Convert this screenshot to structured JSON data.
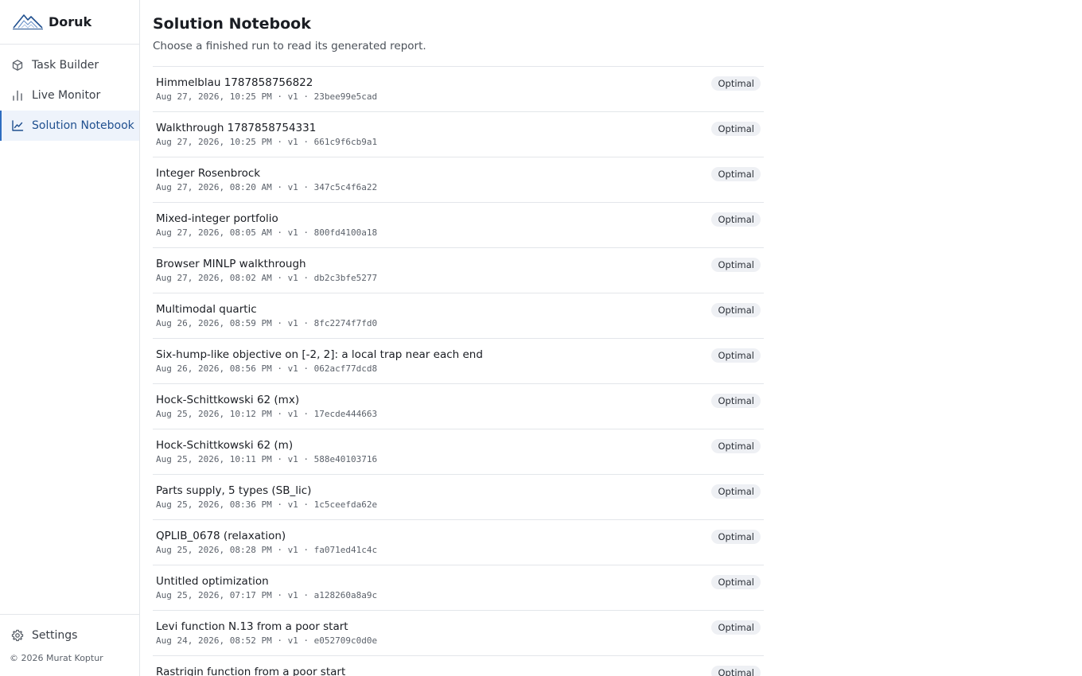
{
  "brand": {
    "name": "Doruk",
    "logo_icon": "mountain-logo-icon",
    "accent": "#2d6cc0"
  },
  "nav": {
    "items": [
      {
        "label": "Task Builder",
        "icon": "cube-icon"
      },
      {
        "label": "Live Monitor",
        "icon": "bar-chart-icon"
      },
      {
        "label": "Solution Notebook",
        "icon": "line-chart-icon",
        "active": true
      }
    ],
    "settings": {
      "label": "Settings",
      "icon": "gear-icon"
    },
    "copyright": "© 2026 Murat Koptur"
  },
  "page": {
    "title": "Solution Notebook",
    "subtitle": "Choose a finished run to read its generated report."
  },
  "runs": [
    {
      "title": "Himmelblau 1787858756822",
      "meta": "Aug 27, 2026, 10:25 PM · v1 · 23bee99e5cad",
      "status": "Optimal"
    },
    {
      "title": "Walkthrough 1787858754331",
      "meta": "Aug 27, 2026, 10:25 PM · v1 · 661c9f6cb9a1",
      "status": "Optimal"
    },
    {
      "title": "Integer Rosenbrock",
      "meta": "Aug 27, 2026, 08:20 AM · v1 · 347c5c4f6a22",
      "status": "Optimal"
    },
    {
      "title": "Mixed-integer portfolio",
      "meta": "Aug 27, 2026, 08:05 AM · v1 · 800fd4100a18",
      "status": "Optimal"
    },
    {
      "title": "Browser MINLP walkthrough",
      "meta": "Aug 27, 2026, 08:02 AM · v1 · db2c3bfe5277",
      "status": "Optimal"
    },
    {
      "title": "Multimodal quartic",
      "meta": "Aug 26, 2026, 08:59 PM · v1 · 8fc2274f7fd0",
      "status": "Optimal"
    },
    {
      "title": "Six-hump-like objective on [-2, 2]: a local trap near each end",
      "meta": "Aug 26, 2026, 08:56 PM · v1 · 062acf77dcd8",
      "status": "Optimal"
    },
    {
      "title": "Hock-Schittkowski 62 (mx)",
      "meta": "Aug 25, 2026, 10:12 PM · v1 · 17ecde444663",
      "status": "Optimal"
    },
    {
      "title": "Hock-Schittkowski 62 (m)",
      "meta": "Aug 25, 2026, 10:11 PM · v1 · 588e40103716",
      "status": "Optimal"
    },
    {
      "title": "Parts supply, 5 types (SB_lic)",
      "meta": "Aug 25, 2026, 08:36 PM · v1 · 1c5ceefda62e",
      "status": "Optimal"
    },
    {
      "title": "QPLIB_0678 (relaxation)",
      "meta": "Aug 25, 2026, 08:28 PM · v1 · fa071ed41c4c",
      "status": "Optimal"
    },
    {
      "title": "Untitled optimization",
      "meta": "Aug 25, 2026, 07:17 PM · v1 · a128260a8a9c",
      "status": "Optimal"
    },
    {
      "title": "Levi function N.13 from a poor start",
      "meta": "Aug 24, 2026, 08:52 PM · v1 · e052709c0d0e",
      "status": "Optimal"
    },
    {
      "title": "Rastrigin function from a poor start",
      "meta": "",
      "status": "Optimal"
    }
  ]
}
